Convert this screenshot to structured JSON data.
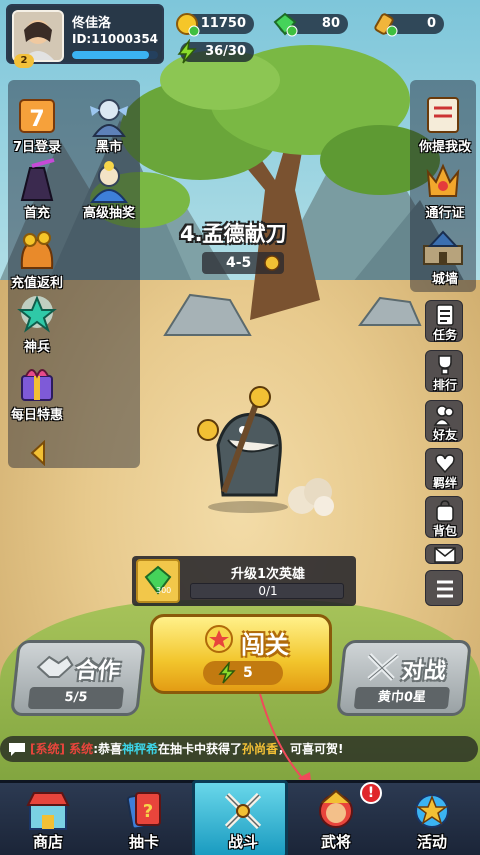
{
  "profile": {
    "name": "佟佳洛",
    "id_text": "ID:11000354",
    "level": "2",
    "exp_fraction": 0.9
  },
  "resources": {
    "gold": "11750",
    "gems": "80",
    "tickets": "0",
    "energy": "36/30"
  },
  "left_menu": [
    {
      "label": "7日登录",
      "icon": "calendar-7-icon"
    },
    {
      "label": "黑市",
      "icon": "merchant-icon"
    },
    {
      "label": "首充",
      "icon": "first-recharge-icon"
    },
    {
      "label": "高级抽奖",
      "icon": "premium-draw-icon"
    },
    {
      "label": "充值返利",
      "icon": "rebate-icon"
    },
    {
      "label": "神兵",
      "icon": "divine-weapon-icon"
    },
    {
      "label": "每日特惠",
      "icon": "daily-deal-icon"
    }
  ],
  "right_menu_top": [
    {
      "label": "你提我改",
      "icon": "feedback-icon"
    },
    {
      "label": "通行证",
      "icon": "battle-pass-icon"
    },
    {
      "label": "城墙",
      "icon": "city-wall-icon"
    }
  ],
  "right_menu_small": [
    {
      "label": "任务",
      "icon": "task-icon"
    },
    {
      "label": "排行",
      "icon": "trophy-icon"
    },
    {
      "label": "好友",
      "icon": "friends-icon"
    },
    {
      "label": "羁绊",
      "icon": "bond-icon"
    },
    {
      "label": "背包",
      "icon": "bag-icon"
    }
  ],
  "stage": {
    "title": "4.孟德献刀",
    "number": "4-5"
  },
  "upgrade": {
    "title": "升级1次英雄",
    "progress": "0/1",
    "cost": "300"
  },
  "buttons": {
    "coop_label": "合作",
    "coop_sub": "5/5",
    "challenge_label": "闯关",
    "challenge_energy": "5",
    "versus_label": "对战",
    "versus_sub": "黄巾0星"
  },
  "chat": {
    "tag": "[系统]",
    "sender": "系统",
    "p1": ":恭喜",
    "player": "神秤希",
    "p2": "在抽卡中获得了",
    "hero": "孙尚香",
    "p3": "，可喜可贺!"
  },
  "nav": [
    {
      "label": "商店",
      "icon": "shop-icon"
    },
    {
      "label": "抽卡",
      "icon": "card-draw-icon"
    },
    {
      "label": "战斗",
      "icon": "battle-icon"
    },
    {
      "label": "武将",
      "icon": "general-icon"
    },
    {
      "label": "活动",
      "icon": "event-icon"
    }
  ],
  "nav_alert": "!",
  "colors": {
    "gold": "#f2c52c",
    "accent_blue": "#1a9bc0",
    "chat_tag": "#e8453c",
    "chat_name": "#3cd4e8",
    "chat_hero": "#f5c236"
  }
}
